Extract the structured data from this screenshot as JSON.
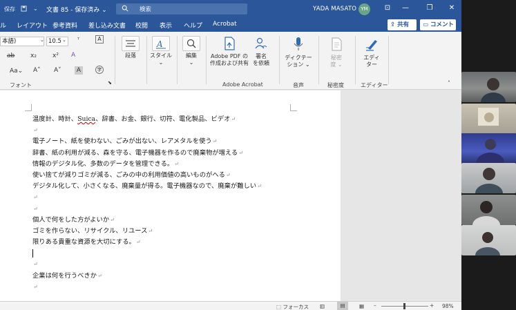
{
  "titlebar": {
    "autosave": "保存",
    "doc_title": "文書 85 - 保存済み ⌄",
    "search_placeholder": "検索",
    "user_name": "YADA MASATO",
    "user_initials": "YM",
    "controls": [
      "⊡",
      "—",
      "❐",
      "✕"
    ]
  },
  "tabs": [
    "ル",
    "レイアウト",
    "参考資料",
    "差し込み文書",
    "校閲",
    "表示",
    "ヘルプ",
    "Acrobat"
  ],
  "share_label": "共有",
  "comment_label": "コメント",
  "ribbon": {
    "font_name": "本語)",
    "font_size": "10.5",
    "font_group_label": "フォント",
    "paragraph": "段落",
    "style": "スタイル",
    "edit": "編集",
    "adobe_pdf": [
      "Adobe PDF の",
      "作成および共有"
    ],
    "sign_request": [
      "署名",
      "を依頼"
    ],
    "adobe_group_label": "Adobe Acrobat",
    "dictate": [
      "ディクテー",
      "ション ⌄"
    ],
    "voice_group_label": "音声",
    "sensitivity": [
      "秘密",
      "度 ⌄"
    ],
    "sensitivity_group_label": "秘密度",
    "editor": [
      "エディ",
      "ター"
    ],
    "editor_group_label": "エディター"
  },
  "document": {
    "lines": [
      "温度計、時計、Suica、辞書、お金、銀行、切符、電化製品、ビデオ",
      "",
      "電子ノート、紙を使わない、ごみが出ない、レアメタルを使う",
      "辞書、紙の利用が減る、森を守る、電子機器を作るので廃棄物が増える",
      "情報のデジタル化、多数のデータを管理できる。",
      "使い捨てが減りゴミが減る、ごみの中の利用価値の高いものがへる",
      "デジタル化して、小さくなる、廃棄量が得る。電子機器なので、廃棄が難しい",
      "",
      "",
      "個人で何をした方がよいか",
      "ゴミを作らない、リサイクル、リユース",
      "限りある貴重な資源を大切にする。",
      "",
      "",
      "企業は何を行うべきか",
      ""
    ],
    "para_mark": "↵"
  },
  "status": {
    "focus_label": "フォーカス",
    "zoom": "98%"
  },
  "colors": {
    "title_blue": "#2b579a",
    "avatar_green": "#68a589",
    "spell_red": "#c00000"
  }
}
